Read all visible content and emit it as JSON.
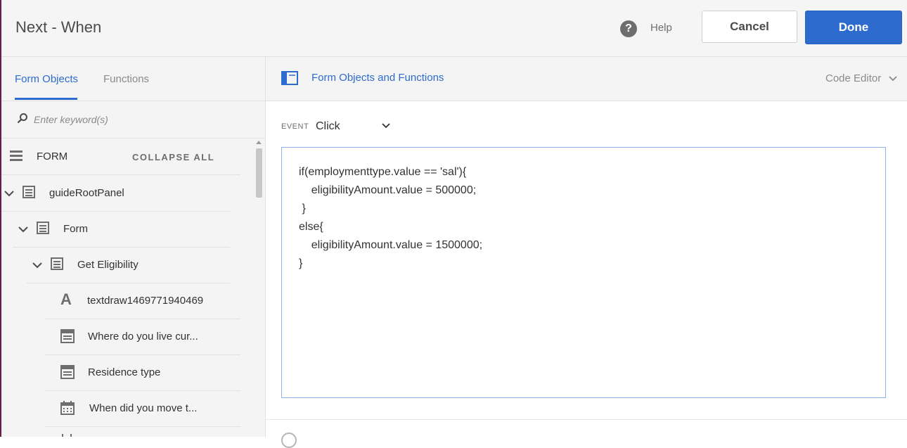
{
  "header": {
    "title": "Next - When",
    "help_label": "Help",
    "cancel_label": "Cancel",
    "done_label": "Done"
  },
  "left_panel": {
    "tabs": [
      {
        "label": "Form Objects",
        "active": true
      },
      {
        "label": "Functions",
        "active": false
      }
    ],
    "search": {
      "placeholder": "Enter keyword(s)"
    },
    "form_header": {
      "label": "FORM",
      "collapse_all": "COLLAPSE ALL"
    },
    "tree": [
      {
        "label": "guideRootPanel",
        "icon": "panel-icon",
        "expanded": true,
        "level": 0
      },
      {
        "label": "Form",
        "icon": "panel-icon",
        "expanded": true,
        "level": 1
      },
      {
        "label": "Get Eligibility",
        "icon": "panel-icon",
        "expanded": true,
        "level": 2
      },
      {
        "label": "textdraw1469771940469",
        "icon": "text-draw-icon",
        "level": 3
      },
      {
        "label": "Where do you live cur...",
        "icon": "dropdown-field-icon",
        "level": 3
      },
      {
        "label": "Residence type",
        "icon": "dropdown-field-icon",
        "level": 3
      },
      {
        "label": "When did you move t...",
        "icon": "calendar-icon",
        "level": 3
      }
    ]
  },
  "right_panel": {
    "header_title": "Form Objects and Functions",
    "code_editor_label": "Code Editor",
    "event": {
      "label": "EVENT",
      "value": "Click"
    },
    "code_lines": [
      "if(employmenttype.value == 'sal'){",
      "    eligibilityAmount.value = 500000;",
      " }",
      "else{",
      "    eligibilityAmount.value = 1500000;",
      "}"
    ]
  },
  "colors": {
    "accent": "#2d6bcf",
    "done_button": "#2d6bcf",
    "panel_bg": "#f4f4f4",
    "code_border": "#8fb1e6"
  }
}
